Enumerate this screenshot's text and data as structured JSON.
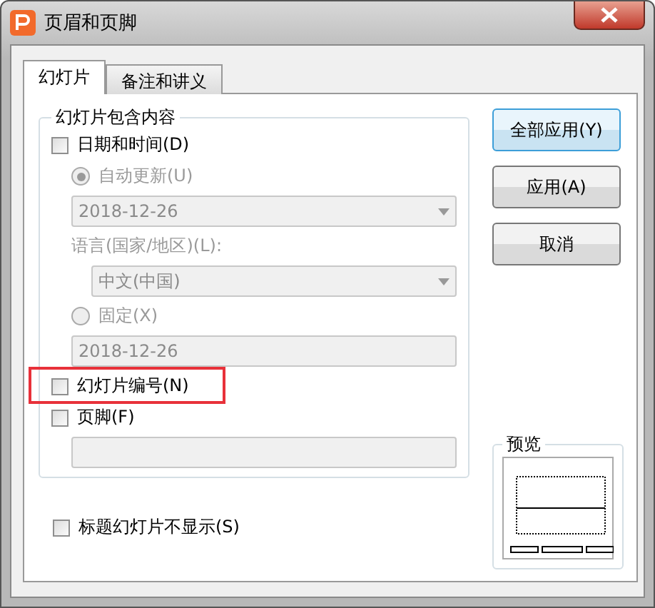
{
  "window": {
    "title": "页眉和页脚"
  },
  "tabs": [
    {
      "label": "幻灯片",
      "selected": true
    },
    {
      "label": "备注和讲义",
      "selected": false
    }
  ],
  "group": {
    "title": "幻灯片包含内容",
    "items": [
      {
        "kind": "checkbox",
        "label": "日期和时间(D)",
        "checked": false,
        "children": [
          {
            "kind": "radio",
            "label": "自动更新(U)",
            "selected": true,
            "disabled": true
          },
          {
            "kind": "dropdown",
            "value": "2018-12-26",
            "disabled": true
          },
          {
            "kind": "label",
            "text": "语言(国家/地区)(L):",
            "disabled": true,
            "children": [
              {
                "kind": "dropdown",
                "value": "中文(中国)",
                "disabled": true
              }
            ]
          },
          {
            "kind": "radio",
            "label": "固定(X)",
            "selected": false,
            "disabled": true
          },
          {
            "kind": "field",
            "value": "2018-12-26",
            "disabled": true
          }
        ]
      },
      {
        "kind": "checkbox",
        "label": "幻灯片编号(N)",
        "checked": false,
        "highlighted": true
      },
      {
        "kind": "checkbox",
        "label": "页脚(F)",
        "checked": false,
        "children": [
          {
            "kind": "field",
            "disabled": true
          }
        ]
      }
    ]
  },
  "title_slide_option": {
    "kind": "checkbox",
    "label": "标题幻灯片不显示(S)",
    "checked": false
  },
  "buttons": [
    {
      "label": "全部应用(Y)",
      "default": true
    },
    {
      "label": "应用(A)",
      "default": false
    },
    {
      "label": "取消",
      "default": false
    }
  ],
  "preview": {
    "title": "预览"
  }
}
